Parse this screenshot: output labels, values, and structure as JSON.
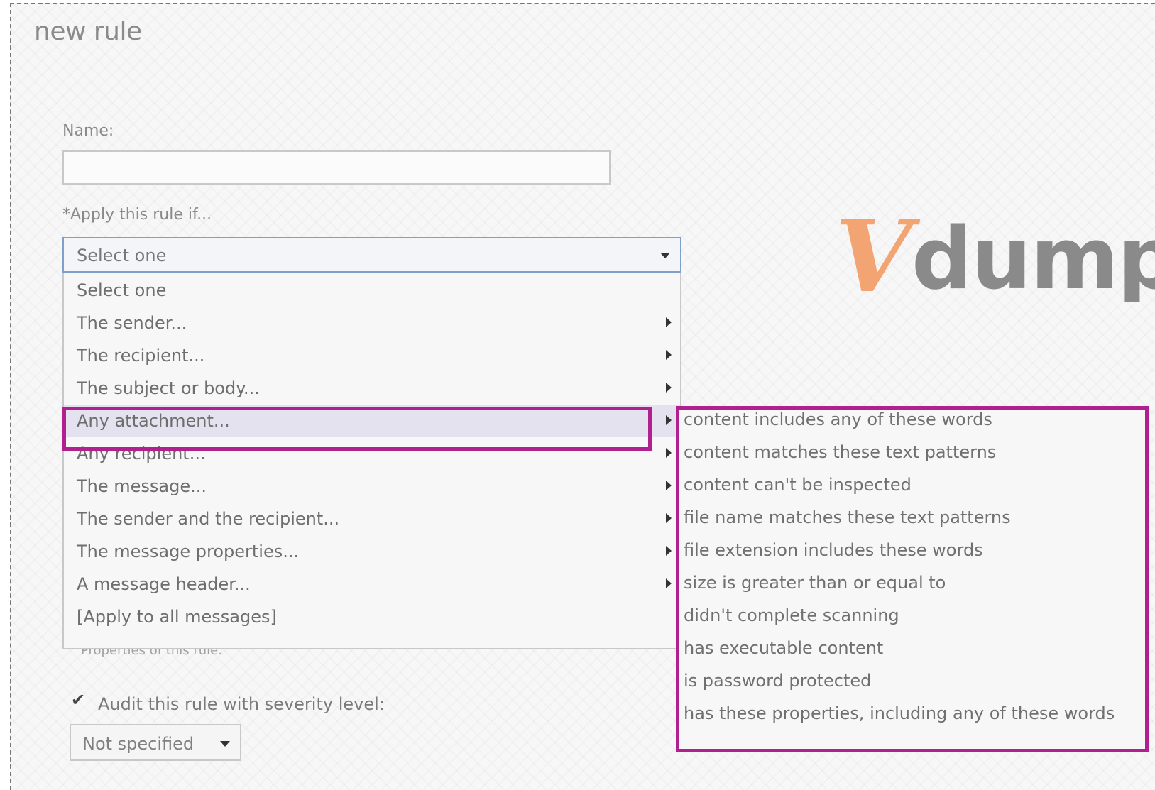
{
  "dialog": {
    "title": "new rule",
    "name_label": "Name:",
    "name_value": "",
    "apply_label": "*Apply this rule if..."
  },
  "condition_select": {
    "selected_value": "Select one",
    "items": [
      {
        "label": "Select one",
        "has_submenu": false
      },
      {
        "label": "The sender...",
        "has_submenu": true
      },
      {
        "label": "The recipient...",
        "has_submenu": true
      },
      {
        "label": "The subject or body...",
        "has_submenu": true
      },
      {
        "label": "Any attachment...",
        "has_submenu": true
      },
      {
        "label": "Any recipient...",
        "has_submenu": true
      },
      {
        "label": "The message...",
        "has_submenu": true
      },
      {
        "label": "The sender and the recipient...",
        "has_submenu": true
      },
      {
        "label": "The message properties...",
        "has_submenu": true
      },
      {
        "label": "A message header...",
        "has_submenu": true
      },
      {
        "label": "[Apply to all messages]",
        "has_submenu": false
      }
    ],
    "highlighted_item": "Any attachment..."
  },
  "attachment_submenu": {
    "items": [
      "content includes any of these words",
      "content matches these text patterns",
      "content can't be inspected",
      "file name matches these text patterns",
      "file extension includes these words",
      "size is greater than or equal to",
      "didn't complete scanning",
      "has executable content",
      "is password protected",
      "has these properties, including any of these words"
    ]
  },
  "properties": {
    "partially_hidden_label": "Properties of this rule:",
    "audit_checked": true,
    "audit_label": "Audit this rule with severity level:",
    "severity_value": "Not specified"
  },
  "watermark": {
    "logo_mark": "V",
    "logo_text": "dump"
  },
  "colors": {
    "highlight_border": "#b0208f",
    "logo_orange": "#f2a472",
    "logo_gray": "#8a8a8a",
    "select_border": "#7fa0c8"
  }
}
